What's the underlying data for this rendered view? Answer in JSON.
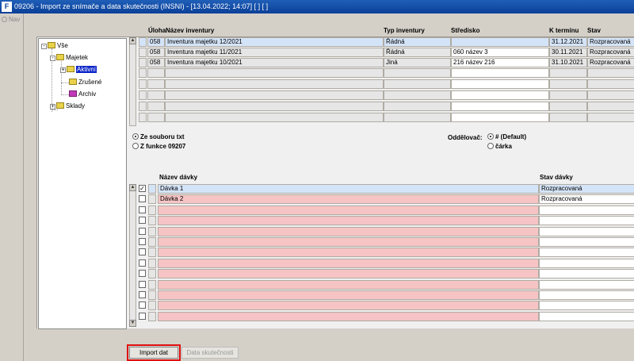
{
  "window": {
    "title": "09206 - Import ze snímače a data skutečnosti (INSNI) - [13.04.2022; 14:07]  [ ] [ ]"
  },
  "nav": {
    "label": "Nav"
  },
  "tree": {
    "root": "Vše",
    "majetek": "Majetek",
    "aktivni": "Aktivní",
    "zrusene": "Zrušené",
    "archiv": "Archiv",
    "sklady": "Sklady"
  },
  "upper_grid": {
    "columns": [
      "Úloha",
      "Název inventury",
      "Typ inventury",
      "Středisko",
      "K termínu",
      "Stav"
    ],
    "rows": [
      {
        "uloha": "058",
        "nazev": "Inventura majetku 12/2021",
        "typ": "Řádná",
        "stredisko": "",
        "termin": "31.12.2021",
        "stav": "Rozpracovaná"
      },
      {
        "uloha": "058",
        "nazev": "Inventura majetku 11/2021",
        "typ": "Řádná",
        "stredisko": "060 název 3",
        "termin": "30.11.2021",
        "stav": "Rozpracovaná"
      },
      {
        "uloha": "058",
        "nazev": "Inventura majetku 10/2021",
        "typ": "Jiná",
        "stredisko": "216 název 216",
        "termin": "31.10.2021",
        "stav": "Rozpracovaná"
      }
    ]
  },
  "source_options": {
    "file": "Ze souboru txt",
    "func": "Z funkce 09207",
    "selected": "file"
  },
  "separator": {
    "label": "Oddělovač:",
    "opt1": "# (Default)",
    "opt2": "čárka",
    "selected": "opt1"
  },
  "lower_grid": {
    "columns": [
      "Název dávky",
      "Stav dávky"
    ],
    "rows": [
      {
        "checked": true,
        "nazev": "Dávka 1",
        "stav": "Rozpracovaná"
      },
      {
        "checked": false,
        "nazev": "Dávka 2",
        "stav": "Rozpracovaná"
      }
    ]
  },
  "buttons": {
    "import": "Import dat",
    "data": "Data skutečnosti"
  },
  "colors": {
    "title_bar": "#0a3f98",
    "selected_row": "#d4e4f8",
    "pink_row": "#f6c4c4",
    "highlight": "#e01010"
  }
}
